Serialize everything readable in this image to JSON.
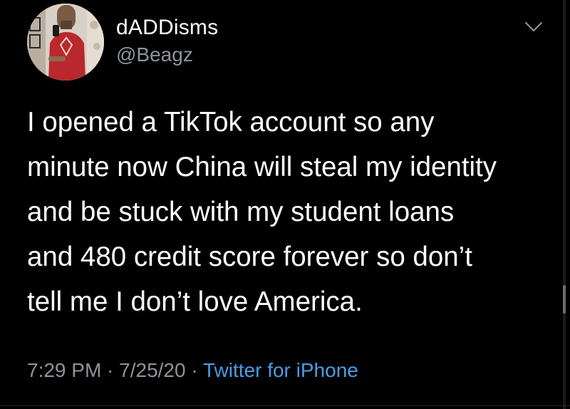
{
  "tweet": {
    "display_name": "dADDisms",
    "handle": "@Beagz",
    "text": "I opened a TikTok account so any\nminute now China will steal my identity\nand be stuck with my student loans\nand 480 credit score forever so don’t\ntell me I don’t love America.",
    "time": "7:29 PM · 7/25/20",
    "separator": "·",
    "source": "Twitter for iPhone",
    "more_icon": "chevron-down-icon",
    "avatar_icon": "profile-photo"
  },
  "colors": {
    "background": "#000000",
    "text": "#ffffff",
    "secondary_text": "#8d949c",
    "link": "#4a9de5"
  }
}
